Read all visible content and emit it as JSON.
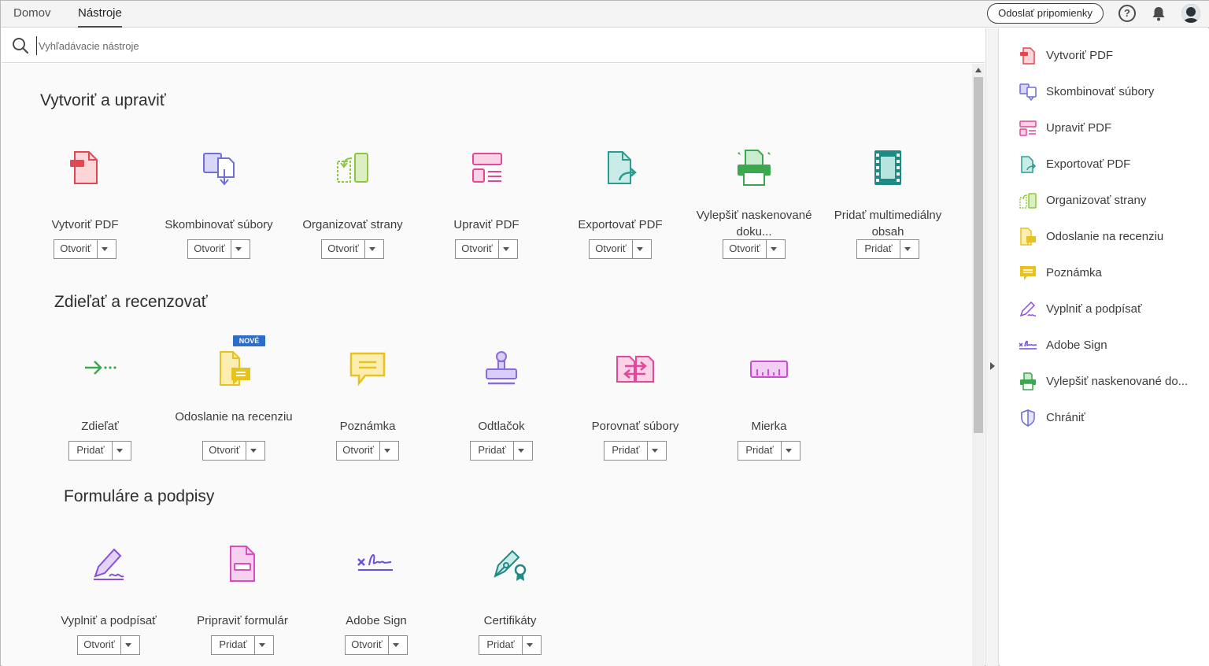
{
  "tabs": [
    {
      "label": "Domov"
    },
    {
      "label": "Nástroje"
    }
  ],
  "header": {
    "comment_button": "Odoslať pripomienky",
    "help_icon": "question-circle-icon",
    "bell_icon": "bell-icon",
    "avatar_icon": "user-avatar"
  },
  "search": {
    "placeholder": "Vyhľadávacie nástroje"
  },
  "sections": [
    {
      "title": "Vytvoriť a upraviť",
      "tools": [
        {
          "name": "Vytvoriť PDF",
          "action": "Otvoriť",
          "icon": "create-pdf-icon",
          "color": "#e34850"
        },
        {
          "name": "Skombinovať súbory",
          "action": "Otvoriť",
          "icon": "combine-files-icon",
          "color": "#6e6fd9"
        },
        {
          "name": "Organizovať strany",
          "action": "Otvoriť",
          "icon": "organize-pages-icon",
          "color": "#8dc63f"
        },
        {
          "name": "Upraviť PDF",
          "action": "Otvoriť",
          "icon": "edit-pdf-icon",
          "color": "#e0489a"
        },
        {
          "name": "Exportovať PDF",
          "action": "Otvoriť",
          "icon": "export-pdf-icon",
          "color": "#2a9d8f"
        },
        {
          "name": "Vylepšiť naskenované doku...",
          "action": "Otvoriť",
          "icon": "enhance-scan-icon",
          "color": "#3da74e"
        },
        {
          "name": "Pridať multimediálny obsah",
          "action": "Pridať",
          "icon": "rich-media-icon",
          "color": "#1f8a84"
        }
      ]
    },
    {
      "title": "Zdieľať a recenzovať",
      "badge": "NOVÉ",
      "tools": [
        {
          "name": "Zdieľať",
          "action": "Pridať",
          "icon": "share-icon",
          "color": "#3da74e"
        },
        {
          "name": "Odoslanie na recenziu",
          "action": "Otvoriť",
          "icon": "send-for-review-icon",
          "color": "#e8c21e"
        },
        {
          "name": "Poznámka",
          "action": "Otvoriť",
          "icon": "comment-icon",
          "color": "#e8c21e"
        },
        {
          "name": "Odtlačok",
          "action": "Pridať",
          "icon": "stamp-icon",
          "color": "#8a6bd9"
        },
        {
          "name": "Porovnať súbory",
          "action": "Pridať",
          "icon": "compare-files-icon",
          "color": "#e0489a"
        },
        {
          "name": "Mierka",
          "action": "Pridať",
          "icon": "measure-icon",
          "color": "#c94fd0"
        }
      ]
    },
    {
      "title": "Formuláre a podpisy",
      "tools": [
        {
          "name": "Vyplniť a podpísať",
          "action": "Otvoriť",
          "icon": "fill-sign-icon",
          "color": "#8a4fd9"
        },
        {
          "name": "Pripraviť formulár",
          "action": "Pridať",
          "icon": "prepare-form-icon",
          "color": "#d94fc0"
        },
        {
          "name": "Adobe Sign",
          "action": "Otvoriť",
          "icon": "adobe-sign-icon",
          "color": "#6c4fd9"
        },
        {
          "name": "Certifikáty",
          "action": "Pridať",
          "icon": "certificates-icon",
          "color": "#1f8a84"
        }
      ]
    }
  ],
  "right_panel": [
    {
      "label": "Vytvoriť PDF",
      "icon": "create-pdf-icon",
      "color": "#e34850"
    },
    {
      "label": "Skombinovať súbory",
      "icon": "combine-files-icon",
      "color": "#6e6fd9"
    },
    {
      "label": "Upraviť PDF",
      "icon": "edit-pdf-icon",
      "color": "#e0489a"
    },
    {
      "label": "Exportovať PDF",
      "icon": "export-pdf-icon",
      "color": "#2a9d8f"
    },
    {
      "label": "Organizovať strany",
      "icon": "organize-pages-icon",
      "color": "#8dc63f"
    },
    {
      "label": "Odoslanie na recenziu",
      "icon": "send-for-review-icon",
      "color": "#e8c21e"
    },
    {
      "label": "Poznámka",
      "icon": "comment-icon",
      "color": "#e8c21e"
    },
    {
      "label": "Vyplniť a podpísať",
      "icon": "fill-sign-icon",
      "color": "#8a4fd9"
    },
    {
      "label": "Adobe Sign",
      "icon": "adobe-sign-icon",
      "color": "#6c4fd9"
    },
    {
      "label": "Vylepšiť naskenované do...",
      "icon": "enhance-scan-icon",
      "color": "#3da74e"
    },
    {
      "label": "Chrániť",
      "icon": "protect-icon",
      "color": "#6e6fd9"
    }
  ]
}
